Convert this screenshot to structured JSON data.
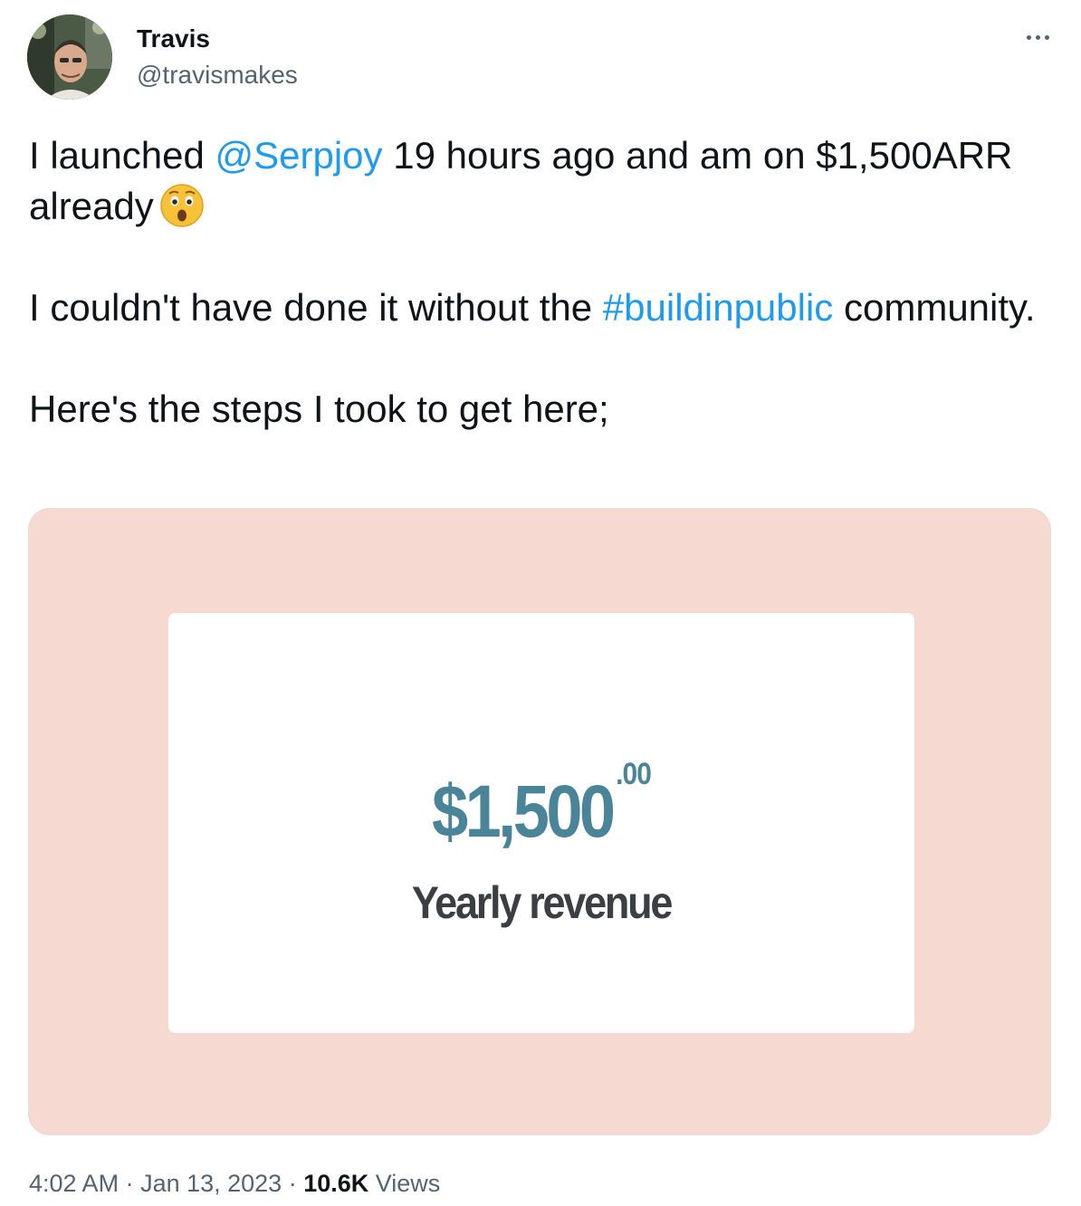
{
  "author": {
    "name": "Travis",
    "handle": "@travismakes"
  },
  "tweet": {
    "line1_pre": "I launched ",
    "mention": "@Serpjoy",
    "line1_post": " 19 hours ago and am on $1,500ARR already",
    "emoji": "astonished-face",
    "line2_pre": "I couldn't have done it without the ",
    "hashtag": "#buildinpublic",
    "line2_post": " community.",
    "line3": "Here's the steps I took to get here;"
  },
  "media": {
    "amount": "$1,500",
    "cents": ".00",
    "caption": "Yearly revenue",
    "background_color": "#f6dad2",
    "amount_color": "#4a8499"
  },
  "meta": {
    "time": "4:02 AM",
    "sep1": " · ",
    "date": "Jan 13, 2023",
    "sep2": " · ",
    "views_count": "10.6K",
    "views_label": " Views"
  },
  "colors": {
    "link": "#1d9bf0",
    "secondary_text": "#536471"
  }
}
